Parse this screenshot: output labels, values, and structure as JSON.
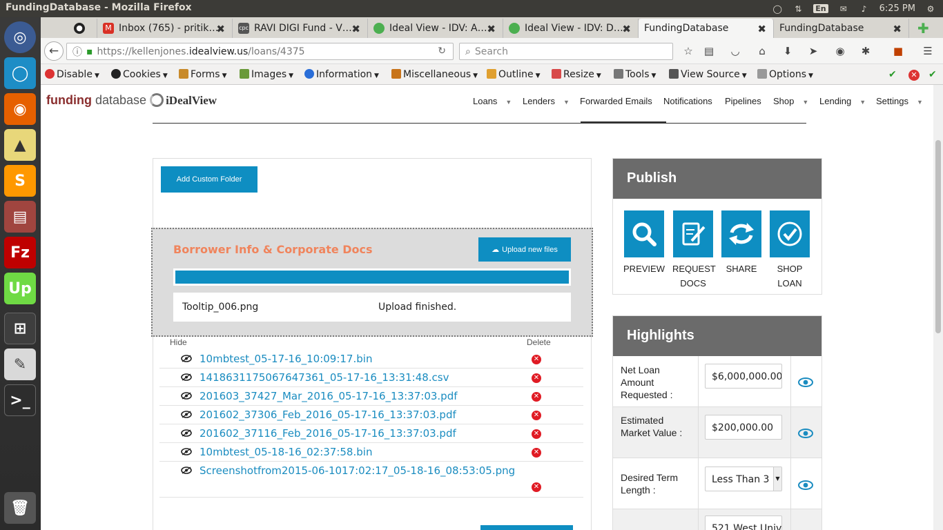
{
  "window": {
    "title": "FundingDatabase - Mozilla Firefox"
  },
  "systray": {
    "lang": "En",
    "clock": "6:25 PM"
  },
  "tabs": [
    {
      "label": "Inbox (765) - pritik…",
      "favicon": "gmail-icon"
    },
    {
      "label": "RAVI DIGI Fund - V…",
      "favicon": "cpc-icon"
    },
    {
      "label": "Ideal View - IDV: A…",
      "favicon": "idv-icon"
    },
    {
      "label": "Ideal View - IDV: D…",
      "favicon": "idv-icon"
    },
    {
      "label": "FundingDatabase",
      "favicon": ""
    },
    {
      "label": "FundingDatabase",
      "favicon": ""
    }
  ],
  "urlbar": {
    "prefix": "https://kellenjones.",
    "domain": "idealview.us",
    "path": "/loans/4375"
  },
  "search": {
    "placeholder": "Search"
  },
  "devtoolbar": {
    "items": [
      "Disable",
      "Cookies",
      "Forms",
      "Images",
      "Information",
      "Miscellaneous",
      "Outline",
      "Resize",
      "Tools",
      "View Source",
      "Options"
    ]
  },
  "site": {
    "logo": {
      "funding": "funding",
      "database": "database",
      "idealview": "iDealView"
    },
    "nav": [
      {
        "label": "Loans",
        "dropdown": true
      },
      {
        "label": "Lenders",
        "dropdown": true
      },
      {
        "label": "Forwarded Emails",
        "dropdown": false
      },
      {
        "label": "Notifications",
        "dropdown": false
      },
      {
        "label": "Pipelines",
        "dropdown": false
      },
      {
        "label": "Shop",
        "dropdown": true
      },
      {
        "label": "Lending",
        "dropdown": true
      },
      {
        "label": "Settings",
        "dropdown": true
      }
    ]
  },
  "folder": {
    "add_button": "Add Custom Folder",
    "title": "Borrower Info & Corporate Docs",
    "upload_button": "Upload new files",
    "upload": {
      "filename": "Tooltip_006.png",
      "status": "Upload finished.",
      "progress": 1.0
    },
    "headers": {
      "hide": "Hide",
      "delete": "Delete"
    },
    "files": [
      "10mbtest_05-17-16_10:09:17.bin",
      "1418631175067647361_05-17-16_13:31:48.csv",
      "201603_37427_Mar_2016_05-17-16_13:37:03.pdf",
      "201602_37306_Feb_2016_05-17-16_13:37:03.pdf",
      "201602_37116_Feb_2016_05-17-16_13:37:03.pdf",
      "10mbtest_05-18-16_02:37:58.bin",
      "Screenshotfrom2015-06-1017:02:17_05-18-16_08:53:05.png"
    ]
  },
  "publish": {
    "title": "Publish",
    "actions": [
      {
        "line1": "PREVIEW",
        "line2": "",
        "icon": "magnifier-icon"
      },
      {
        "line1": "REQUEST",
        "line2": "DOCS",
        "icon": "document-pen-icon"
      },
      {
        "line1": "SHARE",
        "line2": "",
        "icon": "share-arrows-icon"
      },
      {
        "line1": "SHOP",
        "line2": "LOAN",
        "icon": "check-circle-icon"
      }
    ]
  },
  "highlights": {
    "title": "Highlights",
    "rows": [
      {
        "label": "Net Loan Amount Requested :",
        "value": "$6,000,000.00"
      },
      {
        "label": "Estimated Market Value :",
        "value": "$200,000.00"
      },
      {
        "label": "Desired Term Length :",
        "value": "Less Than 3"
      },
      {
        "label": "",
        "value": "521 West Univ"
      }
    ]
  },
  "colors": {
    "accent": "#0e8ec2",
    "folder_title": "#f0845c",
    "box_header": "#6b6b6b"
  }
}
